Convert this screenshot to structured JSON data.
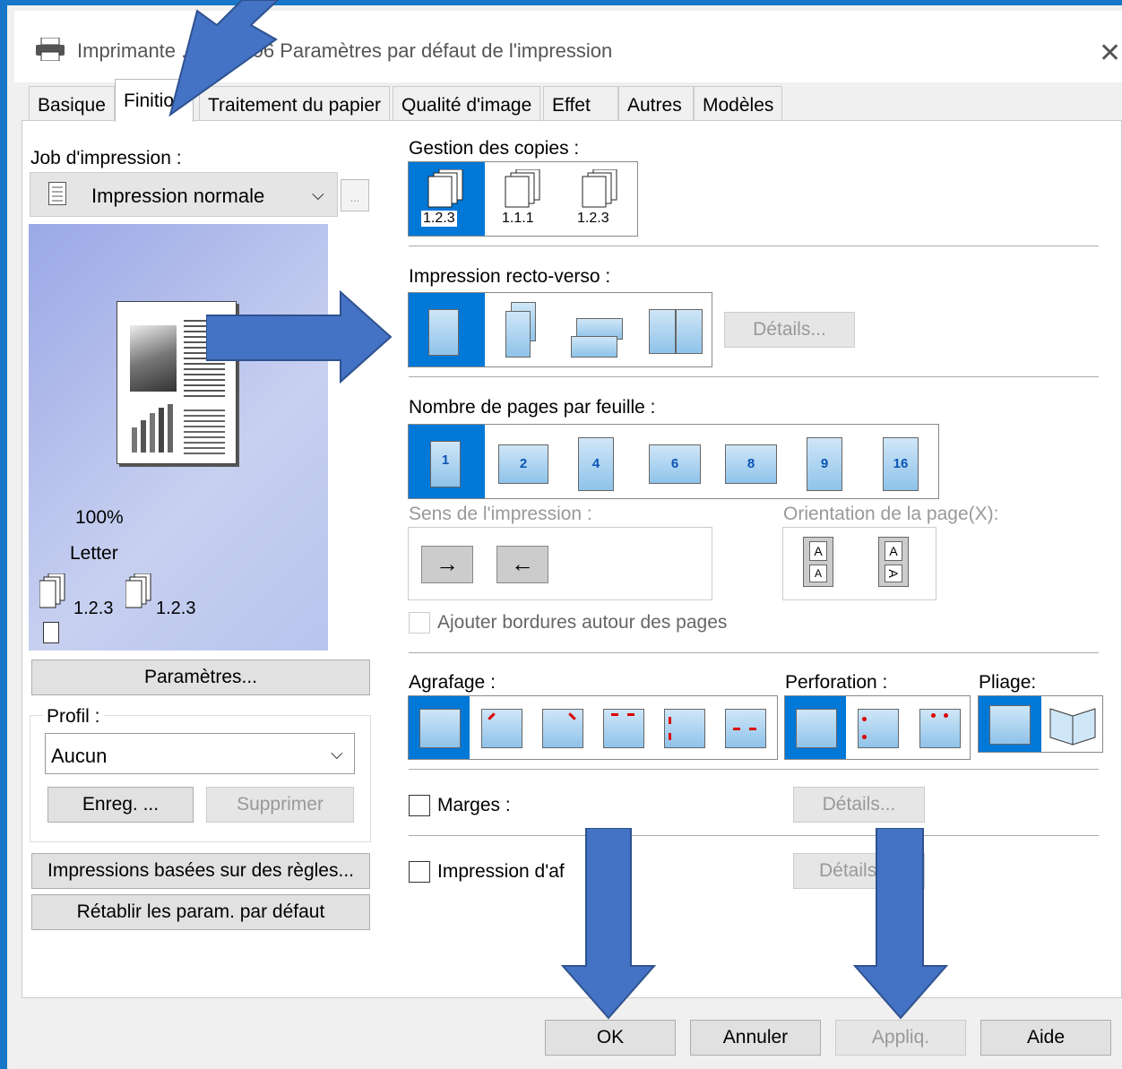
{
  "window": {
    "title": "Imprimante ... nd 7506 Paramètres par défaut de l'impression",
    "close_icon": "close-icon"
  },
  "tabs": [
    "Basique",
    "Finition",
    "Traitement du papier",
    "Qualité d'image",
    "Effet",
    "Autres",
    "Modèles"
  ],
  "active_tab": "Finition",
  "left": {
    "job_label": "Job d'impression :",
    "job_value": "Impression normale",
    "job_more": "...",
    "zoom": "100%",
    "paper": "Letter",
    "collate1": "1.2.3",
    "collate2": "1.2.3",
    "params_button": "Paramètres...",
    "profil_label": "Profil :",
    "profil_value": "Aucun",
    "save_button": "Enreg. ...",
    "delete_button": "Supprimer",
    "rules_button": "Impressions basées sur des règles...",
    "reset_button": "Rétablir les param. par défaut"
  },
  "right": {
    "copies_label": "Gestion des copies :",
    "copies_opts": [
      "1.2.3",
      "1.1.1",
      "1.2.3"
    ],
    "duplex_label": "Impression recto-verso :",
    "duplex_details": "Détails...",
    "nup_label": "Nombre de pages par feuille :",
    "nup_opts": [
      "1",
      "2",
      "4",
      "6",
      "8",
      "9",
      "16"
    ],
    "order_label": "Sens de l'impression :",
    "orient_label": "Orientation de la page(X):",
    "orient_letters": [
      "A",
      "A",
      "A"
    ],
    "border_label": "Ajouter bordures autour des pages",
    "staple_label": "Agrafage :",
    "punch_label": "Perforation :",
    "fold_label": "Pliage:",
    "margins_label": "Marges :",
    "margins_details": "Détails...",
    "poster_label": "Impression d'af",
    "poster_details": "Détails"
  },
  "footer": {
    "ok": "OK",
    "cancel": "Annuler",
    "apply": "Appliq.",
    "help": "Aide"
  },
  "colors": {
    "accent": "#0078d7",
    "arrow": "#4472c4",
    "window_border": "#1677c9"
  }
}
